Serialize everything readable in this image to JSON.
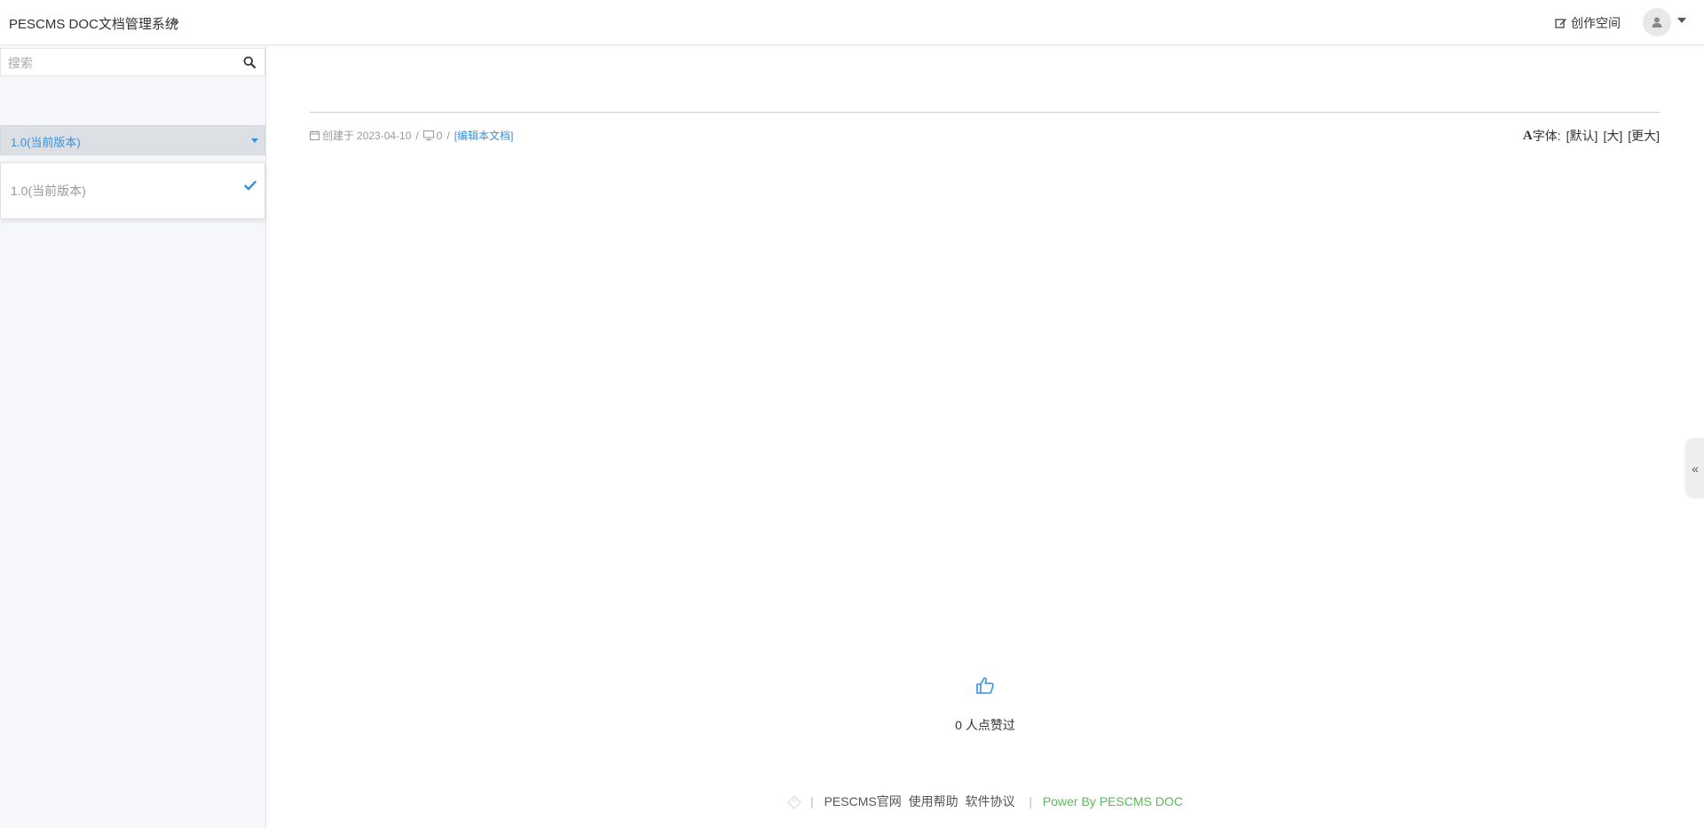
{
  "header": {
    "brand": "PESCMS DOC文档管理系统",
    "expand_glyph": "»",
    "create_label": "创作空间"
  },
  "sidebar": {
    "search": {
      "placeholder": "搜索",
      "value": ""
    },
    "version": {
      "selected": "1.0(当前版本)",
      "options": [
        "1.0(当前版本)"
      ]
    }
  },
  "main": {
    "meta": {
      "created_prefix": "创建于",
      "created_date": "2023-04-10",
      "sep": "/",
      "views": "0",
      "edit_label": "[编辑本文档]"
    },
    "font": {
      "label": "字体:",
      "glyph": "A",
      "options": [
        "[默认]",
        "[大]",
        "[更大]"
      ]
    },
    "likes": {
      "text": "0 人点赞过"
    }
  },
  "footer": {
    "sep": "|",
    "links": [
      "PESCMS官网",
      "使用帮助",
      "软件协议"
    ],
    "power": "Power By PESCMS DOC"
  },
  "toggle": {
    "glyph": "«"
  },
  "colors": {
    "accent": "#3b8fd9",
    "power_green": "#5cb85c"
  },
  "icons": [
    "angle-double-right-icon",
    "edit-icon",
    "user-icon",
    "caret-down-icon",
    "search-icon",
    "check-icon",
    "calendar-icon",
    "desktop-icon",
    "thumbs-up-icon",
    "angle-double-left-icon"
  ]
}
